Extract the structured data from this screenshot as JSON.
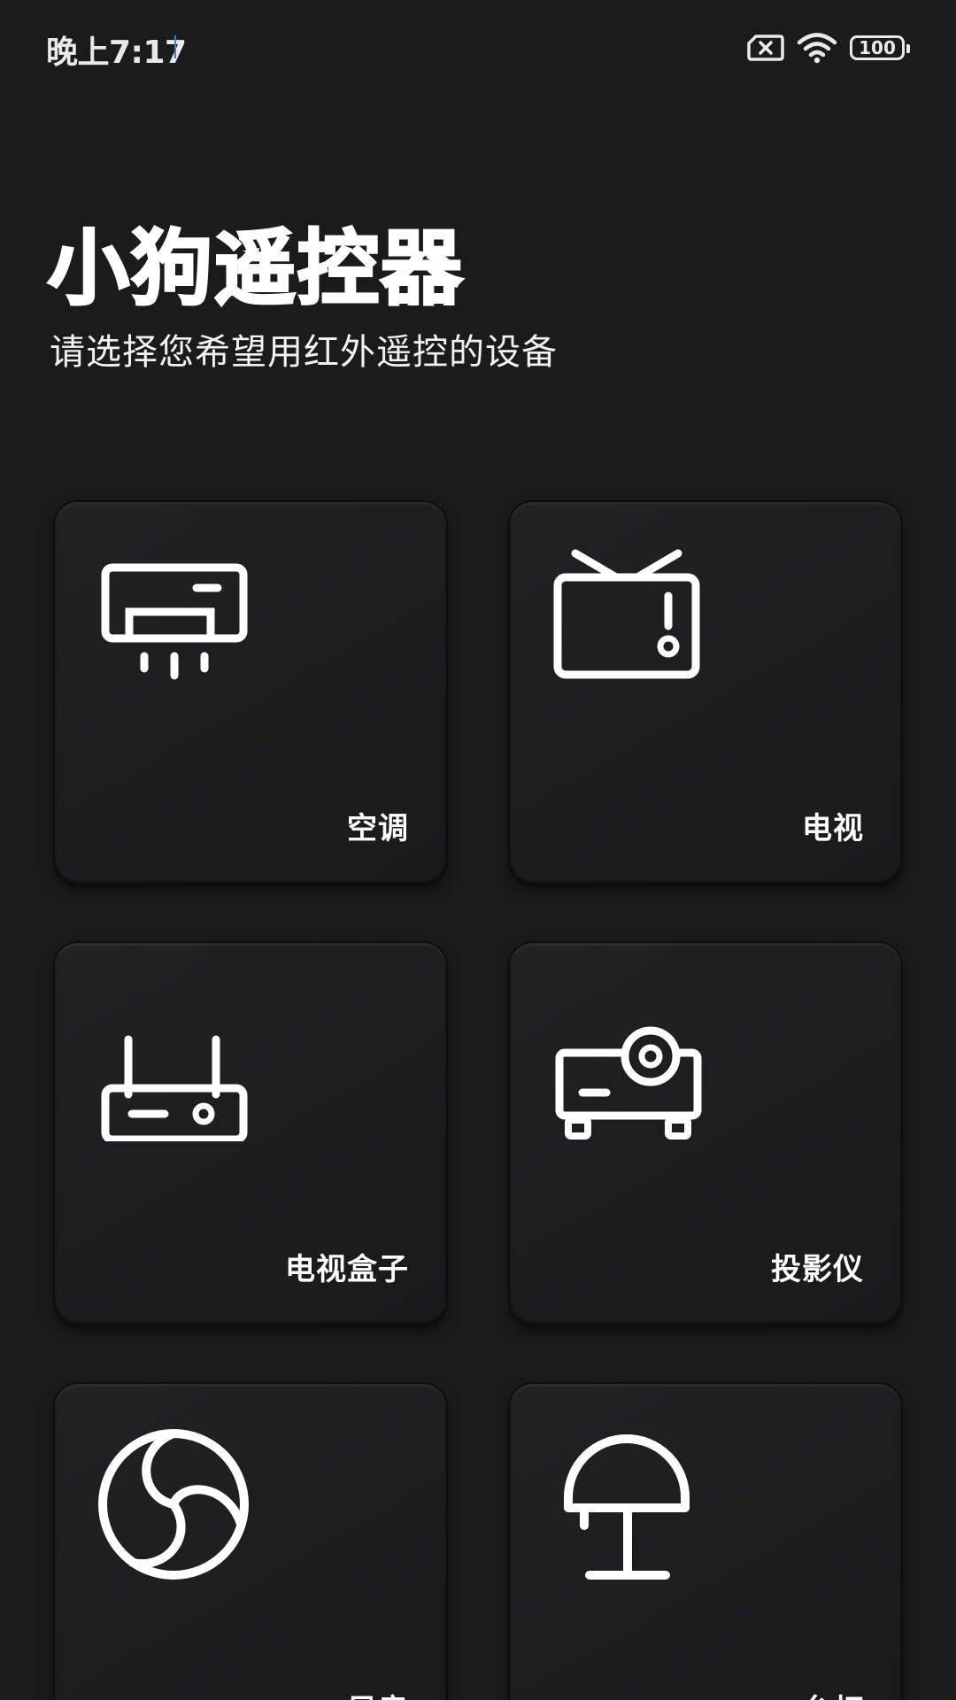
{
  "status_bar": {
    "time": "晚上7:17",
    "battery": "100",
    "icons": [
      "sim-error-icon",
      "wifi-icon",
      "battery-icon"
    ]
  },
  "header": {
    "title": "小狗遥控器",
    "subtitle": "请选择您希望用红外遥控的设备"
  },
  "devices": [
    {
      "label": "空调",
      "icon": "air-conditioner-icon"
    },
    {
      "label": "电视",
      "icon": "tv-icon"
    },
    {
      "label": "电视盒子",
      "icon": "tv-box-icon"
    },
    {
      "label": "投影仪",
      "icon": "projector-icon"
    },
    {
      "label": "风扇",
      "icon": "fan-icon"
    },
    {
      "label": "台灯",
      "icon": "lamp-icon"
    }
  ],
  "colors": {
    "background": "#1b1b1c",
    "card": "#1f1f20",
    "text": "#ffffff"
  }
}
